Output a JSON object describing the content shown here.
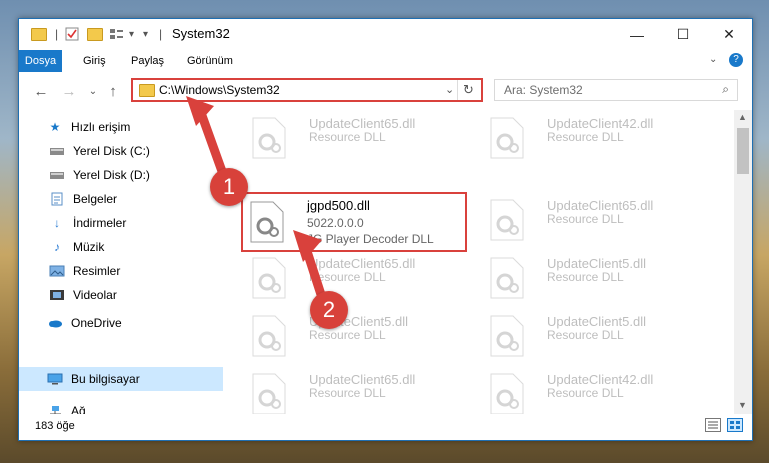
{
  "window": {
    "title": "System32",
    "menu": {
      "file": "Dosya",
      "home": "Giriş",
      "share": "Paylaş",
      "view": "Görünüm"
    }
  },
  "address": {
    "path": "C:\\Windows\\System32",
    "search_placeholder": "Ara: System32"
  },
  "sidebar": {
    "items": [
      {
        "label": "Hızlı erişim"
      },
      {
        "label": "Yerel Disk (C:)"
      },
      {
        "label": "Yerel Disk (D:)"
      },
      {
        "label": "Belgeler"
      },
      {
        "label": "İndirmeler"
      },
      {
        "label": "Müzik"
      },
      {
        "label": "Resimler"
      },
      {
        "label": "Videolar"
      },
      {
        "label": "OneDrive"
      },
      {
        "label": "Bu bilgisayar"
      },
      {
        "label": "Ağ"
      }
    ]
  },
  "files": [
    {
      "name": "UpdateClient65.dll",
      "type": "Resource DLL"
    },
    {
      "name": "UpdateClient42.dll",
      "type": "Resource DLL"
    },
    {
      "name": "jgpd500.dll",
      "version": "5022.0.0.0",
      "type": "JG Player Decoder DLL"
    },
    {
      "name": "UpdateClient65.dll",
      "type": "Resource DLL"
    },
    {
      "name": "UpdateClient65.dll",
      "type": "Resource DLL"
    },
    {
      "name": "UpdateClient5.dll",
      "type": "Resource DLL"
    },
    {
      "name": "UpdateClient5.dll",
      "type": "Resource DLL"
    },
    {
      "name": "UpdateClient5.dll",
      "type": "Resource DLL"
    },
    {
      "name": "UpdateClient65.dll",
      "type": "Resource DLL"
    },
    {
      "name": "UpdateClient42.dll",
      "type": "Resource DLL"
    }
  ],
  "status": {
    "count": "183 öğe"
  },
  "annotations": {
    "step1": "1",
    "step2": "2"
  },
  "colors": {
    "accent": "#1979ca",
    "highlight": "#d9413c"
  }
}
